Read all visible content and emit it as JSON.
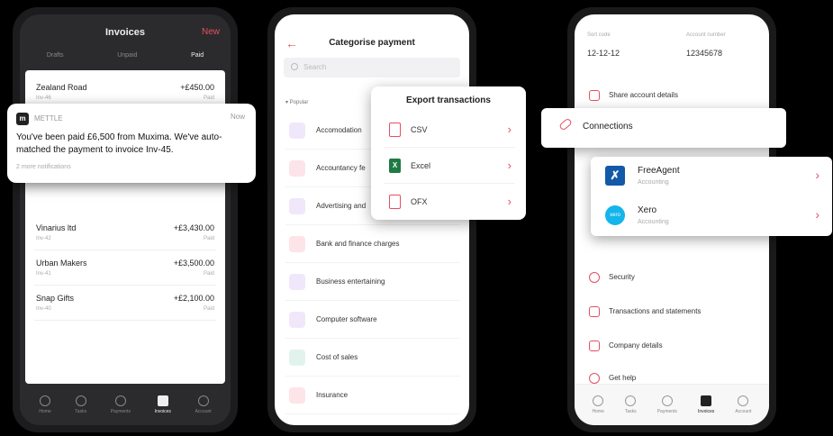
{
  "invoices_screen": {
    "title": "Invoices",
    "new_label": "New",
    "tabs": [
      {
        "label": "Drafts"
      },
      {
        "label": "Unpaid"
      },
      {
        "label": "Paid",
        "active": true
      }
    ],
    "items": [
      {
        "name": "Zealand Road",
        "ref": "Inv-46",
        "amount": "+£450.00",
        "status": "Paid"
      },
      {
        "name": "Vinarius ltd",
        "ref": "Inv-42",
        "amount": "+£3,430.00",
        "status": "Paid"
      },
      {
        "name": "Urban Makers",
        "ref": "Inv-41",
        "amount": "+£3,500.00",
        "status": "Paid"
      },
      {
        "name": "Snap Gifts",
        "ref": "Inv-40",
        "amount": "+£2,100.00",
        "status": "Paid"
      }
    ],
    "notification": {
      "logo": "m",
      "app": "METTLE",
      "time": "Now",
      "message": "You've been paid £6,500 from Muxima. We've auto-matched the payment to invoice Inv-45.",
      "more": "2 more notifications"
    },
    "nav": [
      {
        "label": "Home",
        "icon": "home-icon"
      },
      {
        "label": "Tasks",
        "icon": "check-icon"
      },
      {
        "label": "Payments",
        "icon": "payments-icon"
      },
      {
        "label": "Invoices",
        "icon": "invoice-icon",
        "selected": true
      },
      {
        "label": "Account",
        "icon": "account-icon"
      }
    ]
  },
  "categorise_screen": {
    "back": "←",
    "title": "Categorise payment",
    "search_placeholder": "Search",
    "section": "▾ Popular",
    "categories": [
      {
        "label": "Accomodation",
        "icon": "accommodation-icon"
      },
      {
        "label": "Accountancy fe",
        "icon": "accountancy-icon"
      },
      {
        "label": "Advertising and",
        "icon": "advertising-icon"
      },
      {
        "label": "Bank and finance charges",
        "icon": "bank-icon"
      },
      {
        "label": "Business entertaining",
        "icon": "drink-icon"
      },
      {
        "label": "Computer software",
        "icon": "software-icon"
      },
      {
        "label": "Cost of sales",
        "icon": "tag-icon"
      },
      {
        "label": "Insurance",
        "icon": "umbrella-icon"
      }
    ],
    "export": {
      "title": "Export transactions",
      "options": [
        {
          "label": "CSV",
          "icon": "csv-file-icon"
        },
        {
          "label": "Excel",
          "icon": "excel-icon",
          "badge": "X"
        },
        {
          "label": "OFX",
          "icon": "ofx-file-icon"
        }
      ]
    }
  },
  "account_screen": {
    "sort_code_label": "Sort code",
    "sort_code": "12-12-12",
    "account_number_label": "Account number",
    "account_number": "12345678",
    "share": "Share account details",
    "connections": "Connections",
    "apps": [
      {
        "name": "FreeAgent",
        "sub": "Accounting",
        "logo": "✗"
      },
      {
        "name": "Xero",
        "sub": "Accounting",
        "logo": "xero"
      }
    ],
    "settings": [
      {
        "label": "Security",
        "icon": "security-icon"
      },
      {
        "label": "Transactions and statements",
        "icon": "download-icon"
      },
      {
        "label": "Company details",
        "icon": "company-icon"
      },
      {
        "label": "Get help",
        "icon": "help-icon"
      }
    ],
    "nav": [
      {
        "label": "Home",
        "icon": "home-icon"
      },
      {
        "label": "Tasks",
        "icon": "check-icon"
      },
      {
        "label": "Payments",
        "icon": "payments-icon"
      },
      {
        "label": "Invoices",
        "icon": "invoice-icon",
        "selected": true
      },
      {
        "label": "Account",
        "icon": "account-icon"
      }
    ]
  },
  "colors": {
    "accent": "#e44f62",
    "dark": "#2b2b2d"
  }
}
